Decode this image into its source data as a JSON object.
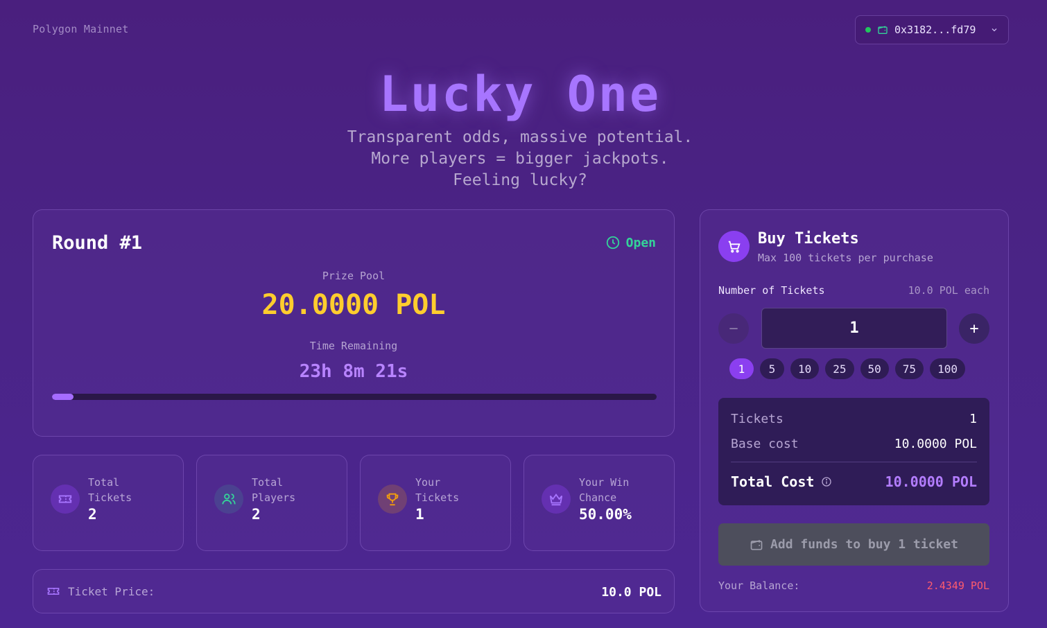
{
  "header": {
    "network": "Polygon Mainnet",
    "wallet_address": "0x3182...fd79"
  },
  "hero": {
    "title": "Lucky One",
    "tagline_1": "Transparent odds, massive potential.",
    "tagline_2": "More players = bigger jackpots.",
    "tagline_3": "Feeling lucky?"
  },
  "round": {
    "title": "Round #1",
    "status": "Open",
    "prize_label": "Prize Pool",
    "prize_value": "20.0000 POL",
    "time_label": "Time Remaining",
    "time_value": "23h 8m 21s",
    "progress_fraction": 0.035
  },
  "stats": [
    {
      "label_1": "Total",
      "label_2": "Tickets",
      "value": "2",
      "icon": "ticket-icon"
    },
    {
      "label_1": "Total",
      "label_2": "Players",
      "value": "2",
      "icon": "users-icon"
    },
    {
      "label_1": "Your",
      "label_2": "Tickets",
      "value": "1",
      "icon": "trophy-icon"
    },
    {
      "label_1": "Your Win",
      "label_2": "Chance",
      "value": "50.00%",
      "icon": "crown-icon"
    }
  ],
  "ticket_price": {
    "label": "Ticket Price:",
    "value": "10.0 POL"
  },
  "buy": {
    "title": "Buy Tickets",
    "subtitle": "Max 100 tickets per purchase",
    "num_label": "Number of Tickets",
    "each": "10.0 POL each",
    "quantity": "1",
    "minus": "−",
    "plus": "+",
    "presets": [
      "1",
      "5",
      "10",
      "25",
      "50",
      "75",
      "100"
    ],
    "summary": {
      "tickets_label": "Tickets",
      "tickets_value": "1",
      "base_label": "Base cost",
      "base_value": "10.0000 POL",
      "total_label": "Total Cost",
      "total_value": "10.0000 POL"
    },
    "button": "Add funds to buy 1 ticket",
    "balance_label": "Your Balance:",
    "balance_value": "2.4349 POL"
  },
  "colors": {
    "accent": "#a775ff",
    "prize": "#ffcd2e",
    "open": "#34d399",
    "balance_low": "#ff5b6e"
  }
}
